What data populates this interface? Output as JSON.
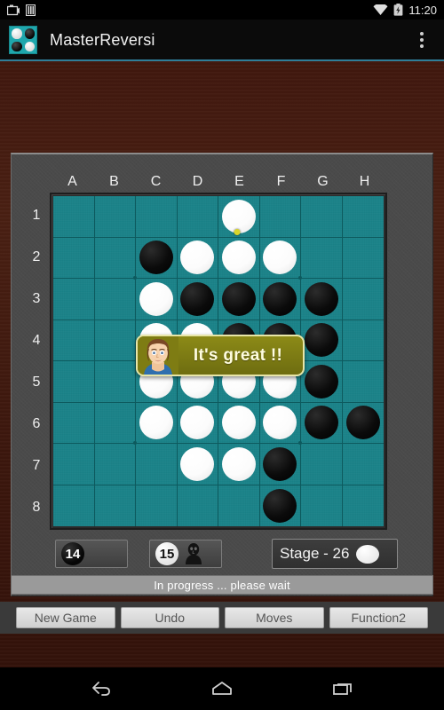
{
  "status_bar": {
    "time": "11:20",
    "icons": [
      "screenshot-icon",
      "sim-icon",
      "wifi-icon",
      "battery-charging-icon"
    ]
  },
  "title_bar": {
    "app_name": "MasterReversi",
    "app_icon": "reversi-app-icon",
    "overflow_label": "more-options"
  },
  "board": {
    "columns": [
      "A",
      "B",
      "C",
      "D",
      "E",
      "F",
      "G",
      "H"
    ],
    "rows": [
      "1",
      "2",
      "3",
      "4",
      "5",
      "6",
      "7",
      "8"
    ],
    "cells": [
      [
        "",
        "",
        "",
        "",
        "W",
        "",
        "",
        ""
      ],
      [
        "",
        "",
        "B",
        "W",
        "W",
        "W",
        "",
        ""
      ],
      [
        "",
        "",
        "W",
        "B",
        "B",
        "B",
        "B",
        ""
      ],
      [
        "",
        "",
        "W",
        "W",
        "B",
        "B",
        "B",
        ""
      ],
      [
        "",
        "",
        "W",
        "W",
        "W",
        "W",
        "B",
        ""
      ],
      [
        "",
        "",
        "W",
        "W",
        "W",
        "W",
        "B",
        "B"
      ],
      [
        "",
        "",
        "",
        "W",
        "W",
        "B",
        "",
        ""
      ],
      [
        "",
        "",
        "",
        "",
        "",
        "B",
        "",
        ""
      ]
    ],
    "last_move": {
      "col": 4,
      "row": 0
    }
  },
  "bubble": {
    "text": "It's great !!",
    "avatar": "female-avatar-icon"
  },
  "scores": {
    "black": {
      "value": "14",
      "disc": "black-disc"
    },
    "white": {
      "value": "15",
      "disc": "white-disc",
      "player_marker": "human-player-icon"
    }
  },
  "stage": {
    "label": "Stage - 26",
    "turn_disc": "white-disc"
  },
  "status": {
    "message": "In progress ... please wait"
  },
  "buttons": [
    {
      "label": "New Game",
      "name": "new-game-button"
    },
    {
      "label": "Undo",
      "name": "undo-button"
    },
    {
      "label": "Moves",
      "name": "moves-button"
    },
    {
      "label": "Function2",
      "name": "function2-button"
    }
  ],
  "nav_bar": {
    "back": "back-icon",
    "home": "home-icon",
    "recents": "recents-icon"
  },
  "colors": {
    "board_green": "#1b8389",
    "wood_brown": "#41180e",
    "panel_grey": "#4a4a4a",
    "accent_teal": "#2f7e99",
    "bubble_olive": "#8c8a17",
    "marker_yellow": "#d9d62a"
  }
}
